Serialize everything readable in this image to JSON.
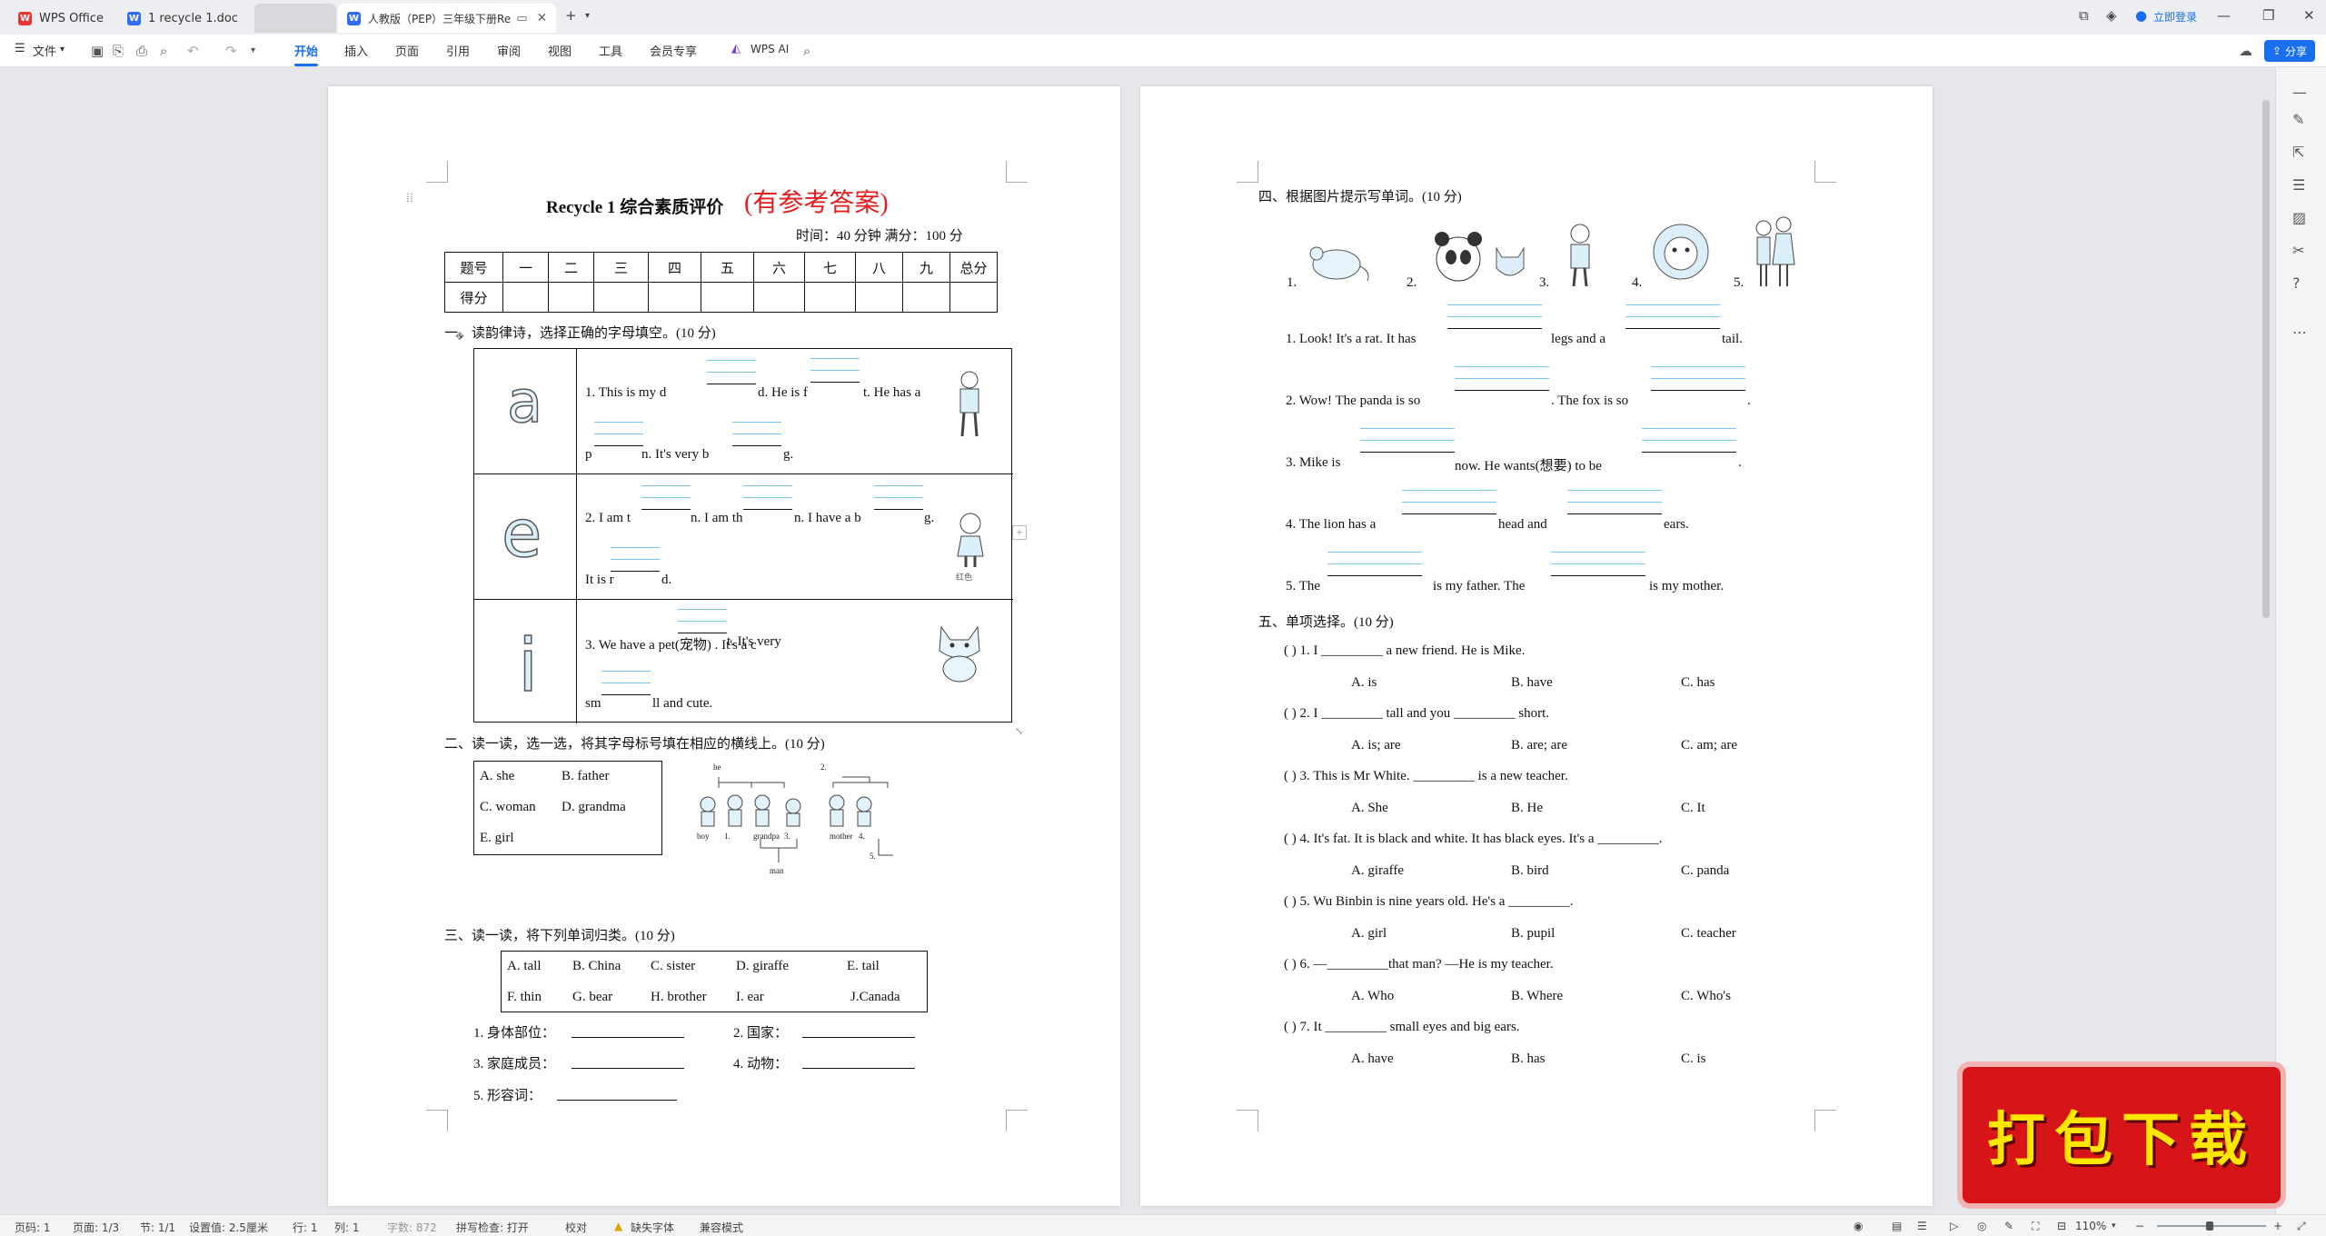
{
  "tabs": [
    {
      "label": "WPS Office"
    },
    {
      "label": "1 recycle 1.doc"
    },
    {
      "label": "人教版（PEP）三年级下册Re"
    }
  ],
  "titlebar": {
    "login": "立即登录"
  },
  "ribbon": {
    "file": "文件",
    "tabs": [
      "开始",
      "插入",
      "页面",
      "引用",
      "审阅",
      "视图",
      "工具",
      "会员专享"
    ],
    "wps_ai": "WPS AI",
    "share": "分享"
  },
  "page1": {
    "title": "Recycle 1  综合素质评价",
    "title_red": "(有参考答案)",
    "meta": "时间：40 分钟    满分：100 分",
    "score_table": {
      "row1": [
        "题号",
        "一",
        "二",
        "三",
        "四",
        "五",
        "六",
        "七",
        "八",
        "九",
        "总分"
      ],
      "row2": [
        "得分",
        "",
        "",
        "",
        "",
        "",
        "",
        "",
        "",
        "",
        ""
      ]
    },
    "s1_heading": "一、读韵律诗，选择正确的字母填空。(10 分)",
    "s1_items": [
      {
        "line1": [
          "1. This is my d",
          "d. He is f",
          "t. He has a"
        ],
        "line2": [
          "p",
          "n. It's very b",
          "g."
        ]
      },
      {
        "line1": [
          "2. I am t",
          "n. I am th",
          "n. I have a b",
          "g."
        ],
        "line2": [
          "It is r",
          "d."
        ]
      },
      {
        "line1": [
          "3. We have a pet(宠物) . It's a c",
          "t. It's very"
        ],
        "line2": [
          "sm",
          "ll and cute."
        ]
      }
    ],
    "s1_letters": [
      "a",
      "e",
      "i"
    ],
    "s1_caption": "红色",
    "s2_heading": "二、读一读，选一选，将其字母标号填在相应的横线上。(10 分)",
    "s2_options": [
      "A. she",
      "B. father",
      "C. woman",
      "D. grandma",
      "E. girl"
    ],
    "s2_tree": {
      "he": "he",
      "n2": "2.",
      "boy": "boy",
      "n1": "1.",
      "grandpa": "grandpa",
      "n3": "3.",
      "mother": "mother",
      "n4": "4.",
      "man": "man",
      "n5": "5."
    },
    "s3_heading": "三、读一读，将下列单词归类。(10 分)",
    "s3_words": [
      [
        "A. tall",
        "B. China",
        "C. sister",
        "D. giraffe",
        "E. tail"
      ],
      [
        "F. thin",
        "G. bear",
        "H. brother",
        "I. ear",
        "J.Canada"
      ]
    ],
    "s3_cats": [
      "1.  身体部位：",
      "2.  国家：",
      "3.  家庭成员：",
      "4.  动物：",
      "5.  形容词："
    ]
  },
  "page2": {
    "s4_heading": "四、根据图片提示写单词。(10 分)",
    "s4_nums": [
      "1.",
      "2.",
      "3.",
      "4.",
      "5."
    ],
    "s4_items": [
      [
        "1. Look! It's a rat. It has",
        "legs and a",
        "tail."
      ],
      [
        "2. Wow! The panda is so",
        ". The fox is so",
        "."
      ],
      [
        "3. Mike is",
        "now. He wants(想要) to be",
        "."
      ],
      [
        "4. The lion has a",
        "head and",
        "ears."
      ],
      [
        "5. The",
        "is my father. The",
        "is my mother."
      ]
    ],
    "s5_heading": "五、单项选择。(10 分)",
    "s5_items": [
      {
        "q": "(          ) 1. I  _________  a new friend. He is Mike.",
        "opts": [
          "A. is",
          "B. have",
          "C. has"
        ]
      },
      {
        "q": "(          ) 2. I  _________  tall and you  _________  short.",
        "opts": [
          "A. is; are",
          "B. are; are",
          "C. am; are"
        ]
      },
      {
        "q": "(          ) 3. This is Mr White.  _________  is a new teacher.",
        "opts": [
          "A. She",
          "B. He",
          "C. It"
        ]
      },
      {
        "q": "(          ) 4. It's fat. It is black and white. It has black eyes. It's a  _________.",
        "opts": [
          "A. giraffe",
          "B. bird",
          "C. panda"
        ]
      },
      {
        "q": "(          ) 5. Wu Binbin is nine years old. He's a  _________.",
        "opts": [
          "A. girl",
          "B. pupil",
          "C. teacher"
        ]
      },
      {
        "q": "(          ) 6.  —_________that man?       —He is my teacher.",
        "opts": [
          "A. Who",
          "B. Where",
          "C. Who's"
        ]
      },
      {
        "q": "(          ) 7. It  _________  small eyes and big ears.",
        "opts": [
          "A. have",
          "B. has",
          "C. is"
        ]
      }
    ]
  },
  "statusbar": {
    "items": [
      "页码: 1",
      "页面: 1/3",
      "节: 1/1",
      "设置值: 2.5厘米",
      "行: 1",
      "列: 1",
      "字数: 872",
      "拼写检查: 打开",
      "校对",
      "缺失字体",
      "兼容模式"
    ],
    "zoom": "110%"
  },
  "badge": "打包下载",
  "colors": {
    "accent": "#1a6ff0",
    "red_title": "#e41e1e",
    "badge_bg": "#d71418",
    "badge_text": "#ffe600"
  }
}
